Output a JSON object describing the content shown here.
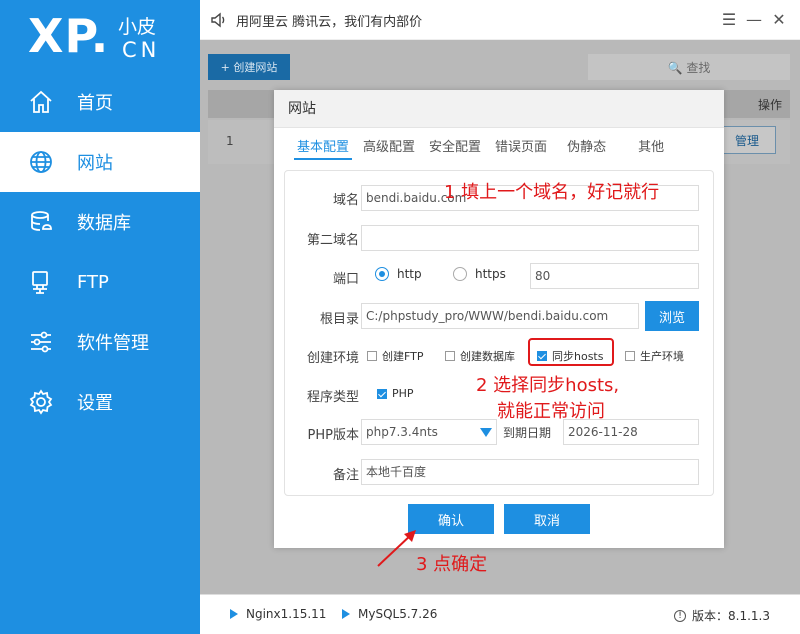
{
  "sidebar": {
    "logo_main": "XP.",
    "logo_small": "小皮",
    "logo_cn": "CN",
    "items": [
      {
        "label": "首页",
        "icon": "home-icon"
      },
      {
        "label": "网站",
        "icon": "globe-icon",
        "active": true
      },
      {
        "label": "数据库",
        "icon": "database-icon"
      },
      {
        "label": "FTP",
        "icon": "monitor-icon"
      },
      {
        "label": "软件管理",
        "icon": "sliders-icon"
      },
      {
        "label": "设置",
        "icon": "gear-icon"
      }
    ]
  },
  "topbar": {
    "notice": "用阿里云 腾讯云，我们有内部价",
    "menu_glyph": "☰",
    "minimize_glyph": "—",
    "close_glyph": "✕"
  },
  "main": {
    "create_label": "+ 创建网站",
    "search_label": "🔍 查找",
    "col_op": "操作",
    "row_num": "1",
    "manage_label": "管理"
  },
  "footer": {
    "nginx": "Nginx1.15.11",
    "mysql": "MySQL5.7.26",
    "version": "版本：8.1.1.3"
  },
  "dialog": {
    "title": "网站",
    "tabs": [
      "基本配置",
      "高级配置",
      "安全配置",
      "错误页面",
      "伪静态",
      "其他"
    ],
    "domain_label": "域名",
    "domain_value": "bendi.baidu.com",
    "second_domain_label": "第二域名",
    "second_domain_value": "",
    "port_label": "端口",
    "http_label": "http",
    "https_label": "https",
    "port_value": "80",
    "root_label": "根目录",
    "root_value": "C:/phpstudy_pro/WWW/bendi.baidu.com",
    "browse_label": "浏览",
    "env_label": "创建环境",
    "env_options": [
      {
        "label": "创建FTP",
        "checked": false
      },
      {
        "label": "创建数据库",
        "checked": false
      },
      {
        "label": "同步hosts",
        "checked": true
      },
      {
        "label": "生产环境",
        "checked": false
      }
    ],
    "program_label": "程序类型",
    "program_php": "PHP",
    "php_version_label": "PHP版本",
    "php_version_value": "php7.3.4nts",
    "expire_label": "到期日期",
    "expire_value": "2026-11-28",
    "note_label": "备注",
    "note_value": "本地千百度",
    "confirm_label": "确认",
    "cancel_label": "取消"
  },
  "annotations": {
    "step1": "1  填上一个域名，好记就行",
    "step2_line1": "2 选择同步hosts,",
    "step2_line2": "就能正常访问",
    "step3": "3 点确定",
    "color": "#e0191b"
  }
}
